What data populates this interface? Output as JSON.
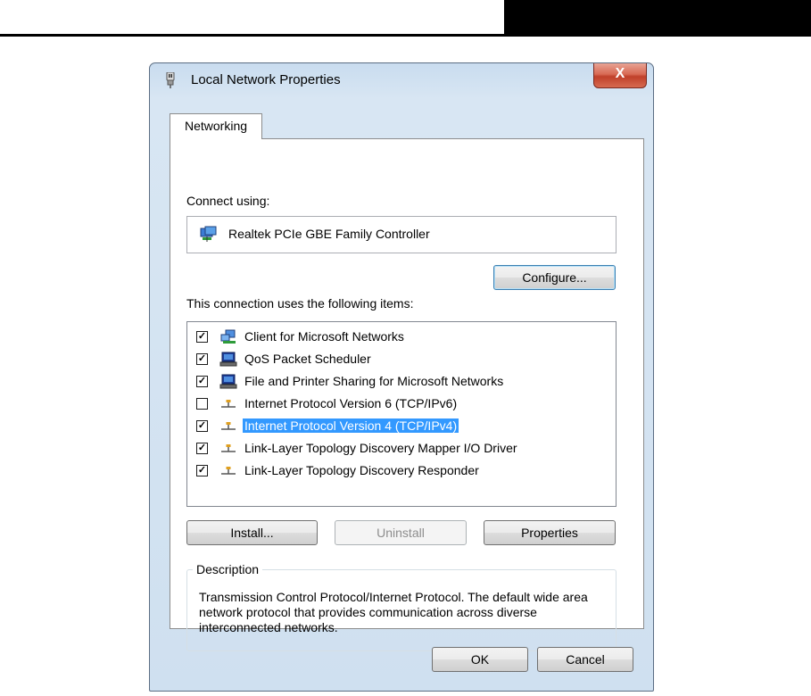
{
  "dialog": {
    "title": "Local Network Properties",
    "close_label": "X"
  },
  "tabs": [
    {
      "label": "Networking"
    }
  ],
  "connect": {
    "label": "Connect using:",
    "adapter": "Realtek PCIe GBE Family Controller",
    "configure_label": "Configure..."
  },
  "items_section": {
    "label": "This connection uses the following items:",
    "items": [
      {
        "label": "Client for Microsoft Networks",
        "checked": true,
        "icon": "network-client-icon"
      },
      {
        "label": "QoS Packet Scheduler",
        "checked": true,
        "icon": "computer-service-icon"
      },
      {
        "label": "File and Printer Sharing for Microsoft Networks",
        "checked": true,
        "icon": "computer-service-icon"
      },
      {
        "label": "Internet Protocol Version 6 (TCP/IPv6)",
        "checked": false,
        "icon": "protocol-icon"
      },
      {
        "label": "Internet Protocol Version 4 (TCP/IPv4)",
        "checked": true,
        "icon": "protocol-icon",
        "selected": true
      },
      {
        "label": "Link-Layer Topology Discovery Mapper I/O Driver",
        "checked": true,
        "icon": "protocol-icon"
      },
      {
        "label": "Link-Layer Topology Discovery Responder",
        "checked": true,
        "icon": "protocol-icon"
      }
    ]
  },
  "actions": {
    "install_label": "Install...",
    "uninstall_label": "Uninstall",
    "properties_label": "Properties"
  },
  "description": {
    "legend": "Description",
    "text": "Transmission Control Protocol/Internet Protocol. The default wide area network protocol that provides communication across diverse interconnected networks."
  },
  "footer": {
    "ok_label": "OK",
    "cancel_label": "Cancel"
  },
  "colors": {
    "selection": "#3399ff",
    "close_button": "#c9462f",
    "frame": "#cfe0f0"
  }
}
